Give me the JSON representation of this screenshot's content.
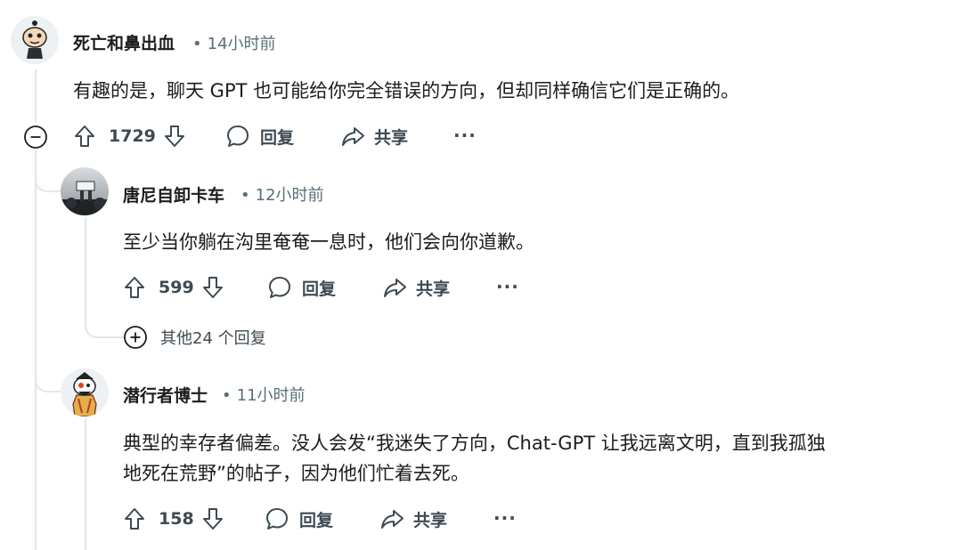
{
  "comments": [
    {
      "username": "死亡和鼻出血",
      "time": "14小时前",
      "text": "有趣的是，聊天 GPT 也可能给你完全错误的方向，但却同样确信它们是正确的。",
      "votes": "1729",
      "reply_label": "回复",
      "share_label": "共享",
      "more_label": "···",
      "avatar_icon": "snoo-avatar-icon"
    },
    {
      "username": "唐尼自卸卡车",
      "time": "12小时前",
      "text": "至少当你躺在沟里奄奄一息时，他们会向你道歉。",
      "votes": "599",
      "reply_label": "回复",
      "share_label": "共享",
      "more_label": "···",
      "more_replies": "其他24 个回复",
      "avatar_icon": "photo-avatar-icon"
    },
    {
      "username": "潜行者博士",
      "time": "11小时前",
      "text_line1": "典型的幸存者偏差。没人会发“我迷失了方向，Chat-GPT 让我远离文明，直到我孤独",
      "text_line2": "地死在荒野”的帖子，因为他们忙着去死。",
      "votes": "158",
      "reply_label": "回复",
      "share_label": "共享",
      "more_label": "···",
      "avatar_icon": "snoo-avatar-icon"
    }
  ],
  "colors": {
    "text": "#1c1c1c",
    "meta": "#576f76",
    "action": "#3e4a52",
    "thread_line": "#e4e6e8"
  }
}
